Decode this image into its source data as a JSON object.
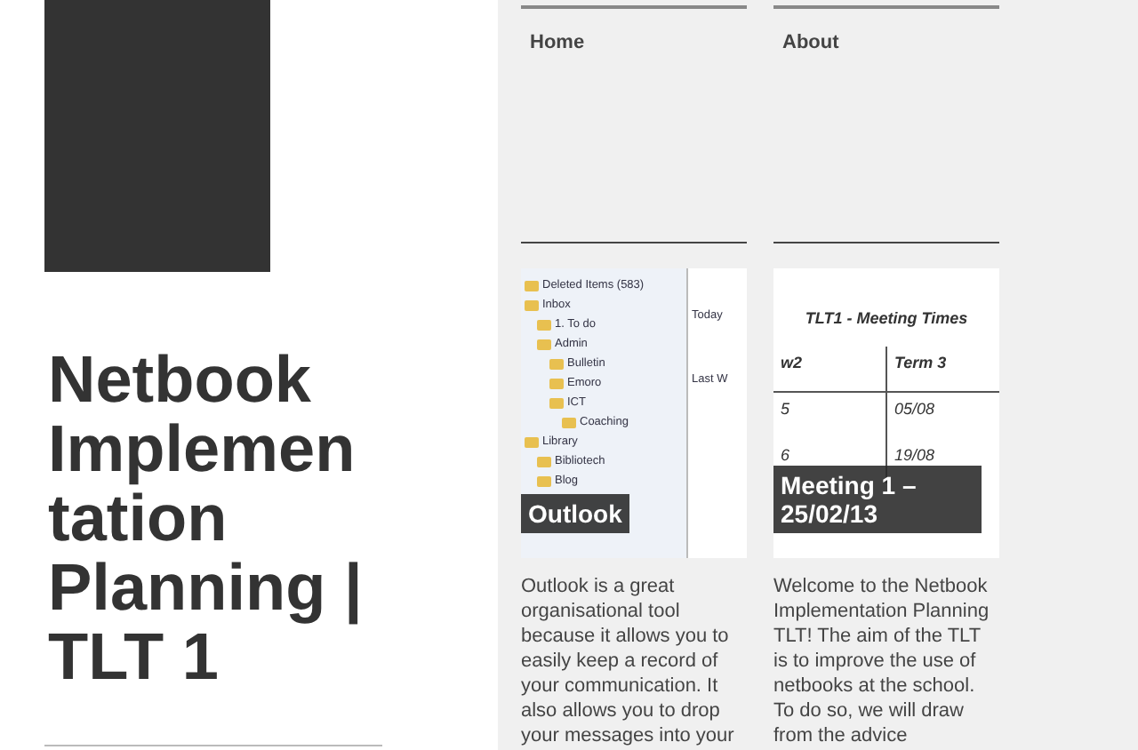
{
  "sidebar": {
    "title": "Netbook Implementation Planning | TLT 1"
  },
  "nav": [
    {
      "label": "Home"
    },
    {
      "label": "About"
    }
  ],
  "posts": [
    {
      "caption": "Outlook",
      "image": {
        "kind": "mail",
        "top_item": "Deleted Items (583)",
        "folders": [
          {
            "label": "Inbox",
            "children": [
              {
                "label": "1. To do"
              },
              {
                "label": "Admin",
                "children": [
                  {
                    "label": "Bulletin"
                  },
                  {
                    "label": "Emoro"
                  },
                  {
                    "label": "ICT",
                    "children": [
                      {
                        "label": "Coaching"
                      }
                    ]
                  }
                ]
              }
            ]
          },
          {
            "label": "Library",
            "children": [
              {
                "label": "Bibliotech"
              },
              {
                "label": "Blog"
              }
            ]
          }
        ],
        "groups": [
          "Today",
          "Last W"
        ]
      },
      "excerpt": "Outlook is a great organisational tool because it allows you to easily keep a record of your communication. It also allows you to drop your messages into your"
    },
    {
      "caption": "Meeting 1 – 25/02/13",
      "image": {
        "kind": "table",
        "title": "TLT1 - Meeting Times",
        "columns": [
          "w2",
          "Term 3"
        ],
        "rows": [
          [
            "5",
            "05/08"
          ],
          [
            "6",
            "19/08"
          ]
        ]
      },
      "excerpt": "Welcome to the Netbook Implementation Planning TLT! The aim of the TLT is to improve the use of netbooks at the school. To do so, we will draw from the advice"
    }
  ]
}
